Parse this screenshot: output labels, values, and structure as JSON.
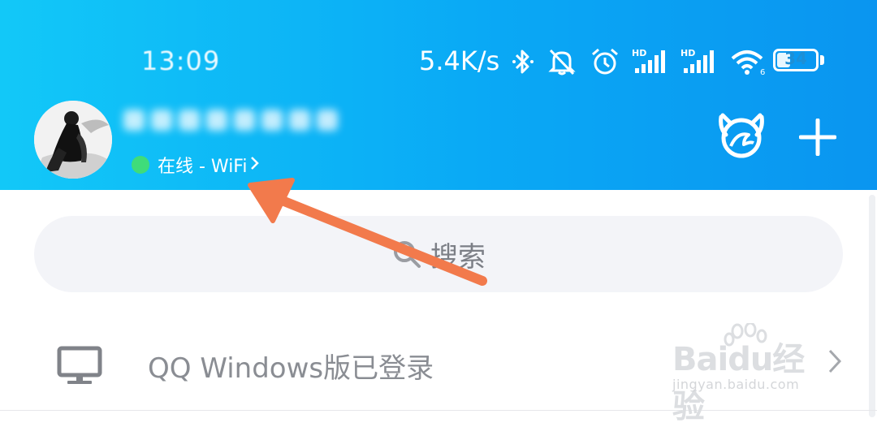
{
  "status_bar": {
    "time": "13:09",
    "net_speed": "5.4K/s",
    "icons": [
      "bluetooth-icon",
      "mute-icon",
      "alarm-icon",
      "signal-hd-icon",
      "signal-hd-icon",
      "wifi-icon"
    ],
    "battery": "34",
    "battery_level": 0.34
  },
  "profile": {
    "status_text": "在线 - WiFi",
    "status_color": "#3fdc7a"
  },
  "header": {
    "gradient_start": "#12c8f8",
    "gradient_end": "#0a95f0",
    "icons": [
      "daily-sign-icon",
      "add-icon"
    ]
  },
  "search": {
    "placeholder": "搜索"
  },
  "device_row": {
    "label": "QQ Windows版已登录",
    "icon": "monitor-icon"
  },
  "watermark": {
    "top": "Baidu经验",
    "bottom": "jingyan.baidu.com"
  },
  "annotation": {
    "type": "arrow",
    "color": "#f27a4c"
  }
}
